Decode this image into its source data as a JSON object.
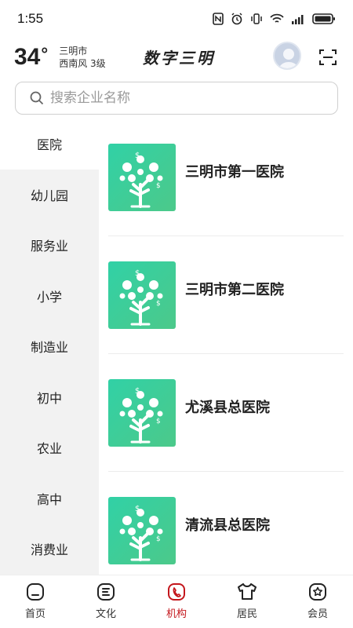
{
  "status": {
    "time": "1:55",
    "battery_icon": "battery-icon"
  },
  "header": {
    "temperature": "34",
    "temperature_unit": "°",
    "city": "三明市",
    "wind": "西南风  3级",
    "brand": "数字三明"
  },
  "search": {
    "placeholder": "搜索企业名称"
  },
  "categories": [
    {
      "label": "医院",
      "active": true
    },
    {
      "label": "幼儿园"
    },
    {
      "label": "服务业"
    },
    {
      "label": "小学"
    },
    {
      "label": "制造业"
    },
    {
      "label": "初中"
    },
    {
      "label": "农业"
    },
    {
      "label": "高中"
    },
    {
      "label": "消费业"
    }
  ],
  "institutions": [
    {
      "name": "三明市第一医院"
    },
    {
      "name": "三明市第二医院"
    },
    {
      "name": "尤溪县总医院"
    },
    {
      "name": "清流县总医院"
    }
  ],
  "nav": [
    {
      "label": "首页",
      "icon": "home-icon"
    },
    {
      "label": "文化",
      "icon": "culture-icon"
    },
    {
      "label": "机构",
      "icon": "institution-icon",
      "active": true
    },
    {
      "label": "居民",
      "icon": "resident-icon"
    },
    {
      "label": "会员",
      "icon": "member-icon"
    }
  ],
  "colors": {
    "accent": "#c4161c",
    "thumb_green": "#3dcf98",
    "sidebar_bg": "#f2f2f2"
  }
}
